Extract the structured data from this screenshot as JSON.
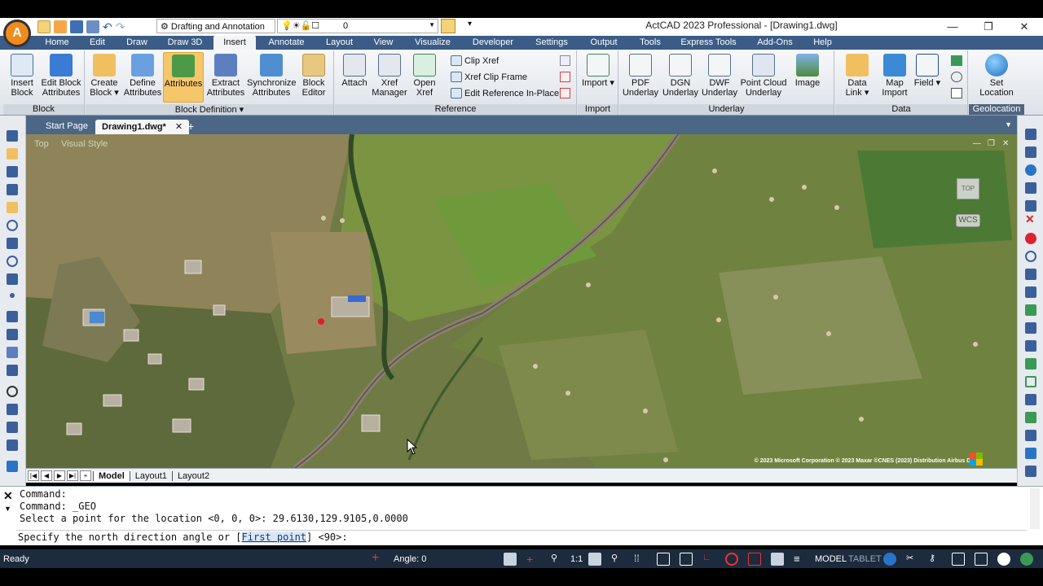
{
  "window": {
    "title": "ActCAD 2023 Professional - [Drawing1.dwg]",
    "workspace": "Drafting and Annotation",
    "layer": "0",
    "minimize": "—",
    "restore": "❐",
    "close": "✕"
  },
  "menu": [
    "Home",
    "Edit",
    "Draw",
    "Draw 3D",
    "Insert",
    "Annotate",
    "Layout",
    "View",
    "Visualize",
    "Developer",
    "Settings",
    "Output",
    "Tools",
    "Express Tools",
    "Add-Ons",
    "Help"
  ],
  "ribbon": {
    "block_panel": {
      "label": "Block",
      "insert_block": "Insert Block",
      "edit_block_attributes": "Edit Block Attributes"
    },
    "block_def_panel": {
      "label": "Block Definition ▾",
      "create_block": "Create Block ▾",
      "define_attributes": "Define Attributes",
      "attributes": "Attributes",
      "extract_attributes": "Extract Attributes",
      "synchronize_attributes": "Synchronize Attributes",
      "block_editor": "Block Editor"
    },
    "reference_panel": {
      "label": "Reference",
      "attach": "Attach",
      "xref_manager": "Xref Manager",
      "open_xref": "Open Xref",
      "clip_xref": "Clip Xref",
      "xref_clip_frame": "Xref Clip Frame",
      "edit_reference_in_place": "Edit Reference In-Place"
    },
    "import_panel": {
      "label": "Import",
      "import": "Import ▾"
    },
    "underlay_panel": {
      "label": "Underlay",
      "pdf_underlay": "PDF Underlay",
      "dgn_underlay": "DGN Underlay",
      "dwf_underlay": "DWF Underlay",
      "point_cloud_underlay": "Point Cloud Underlay",
      "image": "Image"
    },
    "data_panel": {
      "label": "Data",
      "data_link": "Data Link ▾",
      "map_import": "Map Import",
      "field": "Field ▾"
    },
    "geolocation_panel": {
      "label": "Geolocation",
      "set_location": "Set Location"
    }
  },
  "doc_tabs": {
    "start_page": "Start Page",
    "drawing": "Drawing1.dwg*",
    "close": "✕",
    "add": "+"
  },
  "viewport": {
    "view_label": "Top",
    "style_label": "Visual Style",
    "viewcube_face": "TOP",
    "wcs": "WCS",
    "copyright": "© 2023 Microsoft Corporation © 2023 Maxar ©CNES (2023) Distribution Airbus DS"
  },
  "layout_tabs": {
    "nav": [
      "|◀",
      "◀",
      "▶",
      "▶|",
      "+"
    ],
    "tabs": [
      "Model",
      "Layout1",
      "Layout2"
    ]
  },
  "command": {
    "history": [
      "Command:",
      "Command: _GEO",
      "Select a point for the location <0, 0, 0>: 29.6130,129.9105,0.0000"
    ],
    "prompt_before": "Specify the north direction angle or [",
    "prompt_option": "First point",
    "prompt_after": "] <90>:"
  },
  "status": {
    "ready": "Ready",
    "angle": "Angle: 0",
    "scale": "1:1",
    "model": "MODEL",
    "tablet": "TABLET"
  },
  "colors": {
    "menubar": "#3a5c86",
    "accent": "#f6c66b",
    "statusbar": "#1c2b3d"
  }
}
